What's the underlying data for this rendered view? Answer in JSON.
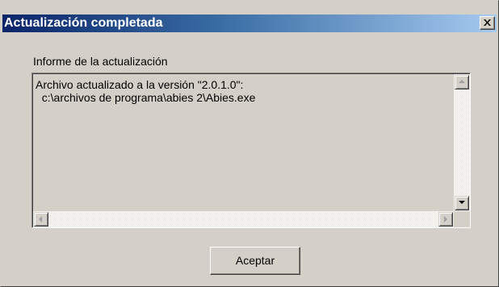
{
  "window": {
    "title": "Actualización completada"
  },
  "report": {
    "label": "Informe de la actualización",
    "text": "Archivo actualizado a la versión \"2.0.1.0\":\n  c:\\archivos de programa\\abies 2\\Abies.exe"
  },
  "buttons": {
    "ok_label": "Aceptar",
    "close_label": "×"
  }
}
